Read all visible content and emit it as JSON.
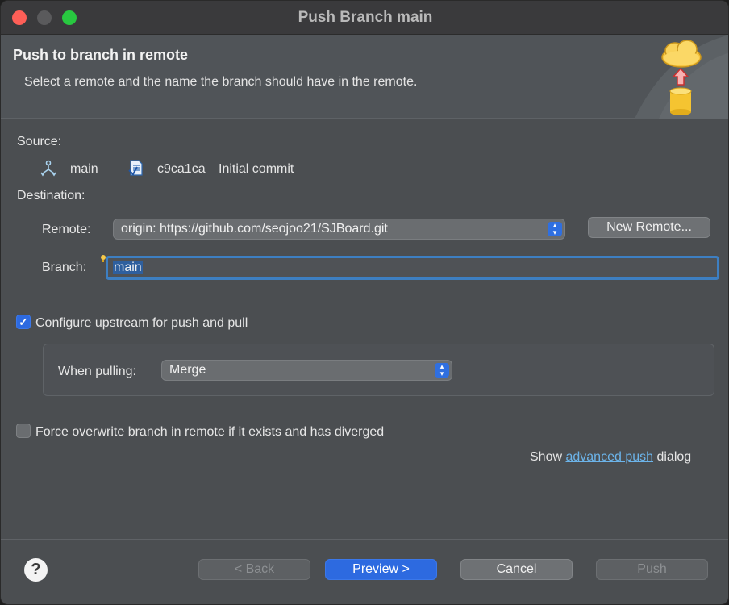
{
  "window": {
    "title": "Push Branch main"
  },
  "banner": {
    "title": "Push to branch in remote",
    "description": "Select a remote and the name the branch should have in the remote."
  },
  "source": {
    "label": "Source:",
    "branch": "main",
    "commit_id": "c9ca1ca",
    "commit_message": "Initial commit"
  },
  "destination": {
    "label": "Destination:",
    "remote_label": "Remote:",
    "remote_value": "origin: https://github.com/seojoo21/SJBoard.git",
    "new_remote_button": "New Remote...",
    "branch_label": "Branch:",
    "branch_value": "main"
  },
  "upstream": {
    "checkbox_label": "Configure upstream for push and pull",
    "checked": true,
    "when_pulling_label": "When pulling:",
    "when_pulling_value": "Merge"
  },
  "force": {
    "checkbox_label": "Force overwrite branch in remote if it exists and has diverged",
    "checked": false
  },
  "advanced": {
    "prefix": "Show",
    "link": "advanced push",
    "suffix": "dialog"
  },
  "footer": {
    "help": "?",
    "back": "< Back",
    "preview": "Preview >",
    "cancel": "Cancel",
    "push": "Push"
  },
  "colors": {
    "accent": "#2d6ae0",
    "link": "#6cb4ea",
    "background": "#4b4e51"
  }
}
